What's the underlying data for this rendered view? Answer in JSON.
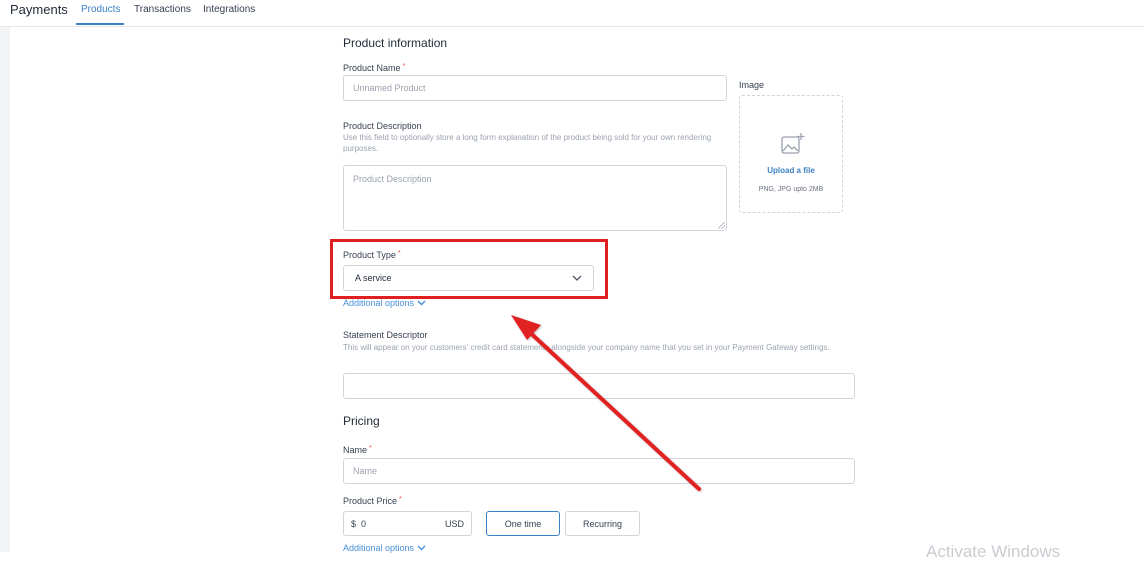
{
  "header": {
    "app_title": "Payments",
    "tabs": [
      {
        "label": "Products",
        "active": true
      },
      {
        "label": "Transactions",
        "active": false
      },
      {
        "label": "Integrations",
        "active": false
      }
    ]
  },
  "product_information": {
    "section_title": "Product information",
    "name_label": "Product Name",
    "required_mark": "*",
    "name_placeholder": "Unnamed Product",
    "image_label": "Image",
    "upload_link": "Upload a file",
    "upload_hint": "PNG, JPG upto 2MB",
    "description_label": "Product Description",
    "description_help": "Use this field to optionally store a long form explanation of the product being sold for your own rendering purposes.",
    "description_placeholder": "Product Description",
    "type_label": "Product Type",
    "type_value": "A service",
    "additional_options": "Additional options",
    "statement_label": "Statement Descriptor",
    "statement_help": "This will appear on your customers' credit card statements alongside your company name that you set in your Payment Gateway settings.",
    "statement_value": ""
  },
  "pricing": {
    "section_title": "Pricing",
    "name_label": "Name",
    "name_placeholder": "Name",
    "price_label": "Product Price",
    "currency_symbol": "$",
    "price_value": "0",
    "currency_code": "USD",
    "one_time_label": "One time",
    "recurring_label": "Recurring",
    "selected_billing": "One time",
    "additional_options": "Additional options"
  },
  "annotation": {
    "highlight_color": "#e02020"
  },
  "watermark": {
    "text": "Activate Windows"
  },
  "icons": [
    "image-add-icon",
    "chevron-down-icon",
    "arrow-pointer"
  ]
}
